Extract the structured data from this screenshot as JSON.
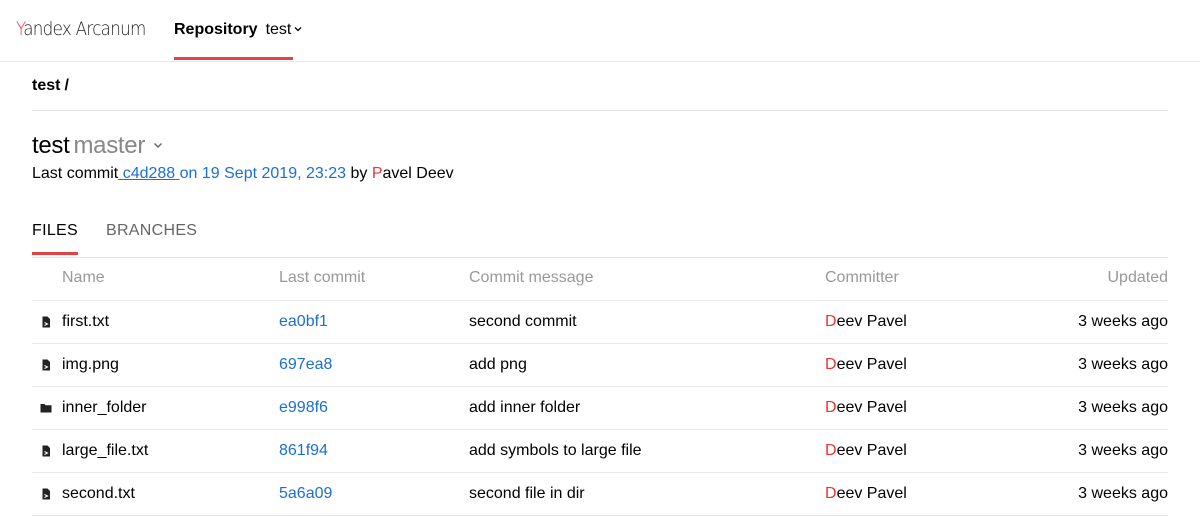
{
  "header": {
    "logo_first_letter": "Y",
    "logo_rest": "andex Arcanum",
    "nav_label": "Repository",
    "repo_name": "test"
  },
  "breadcrumb": {
    "item": "test",
    "separator": "/"
  },
  "repo": {
    "name": "test",
    "branch": "master"
  },
  "last_commit": {
    "prefix": "Last commit",
    "hash": " c4d288 ",
    "on": "on ",
    "date": "19 Sept 2019, 23:23",
    "by": " by ",
    "author_initial": "P",
    "author_rest": "avel Deev"
  },
  "tabs": [
    "FILES",
    "BRANCHES"
  ],
  "table": {
    "headers": [
      "Name",
      "Last commit",
      "Commit message",
      "Committer",
      "Updated"
    ],
    "rows": [
      {
        "type": "file-icon",
        "name": "first.txt",
        "commit": "ea0bf1",
        "message": "second commit",
        "committer_initial": "D",
        "committer_rest": "eev Pavel",
        "updated": "3 weeks ago"
      },
      {
        "type": "file-icon",
        "name": "img.png",
        "commit": "697ea8",
        "message": "add png",
        "committer_initial": "D",
        "committer_rest": "eev Pavel",
        "updated": "3 weeks ago"
      },
      {
        "type": "folder-icon",
        "name": "inner_folder",
        "commit": "e998f6",
        "message": "add inner folder",
        "committer_initial": "D",
        "committer_rest": "eev Pavel",
        "updated": "3 weeks ago"
      },
      {
        "type": "file-icon",
        "name": "large_file.txt",
        "commit": "861f94",
        "message": "add symbols to large file",
        "committer_initial": "D",
        "committer_rest": "eev Pavel",
        "updated": "3 weeks ago"
      },
      {
        "type": "file-icon",
        "name": "second.txt",
        "commit": "5a6a09",
        "message": "second file in dir",
        "committer_initial": "D",
        "committer_rest": "eev Pavel",
        "updated": "3 weeks ago"
      }
    ]
  },
  "colors": {
    "accent": "#e54141",
    "link": "#1a6fd6"
  }
}
